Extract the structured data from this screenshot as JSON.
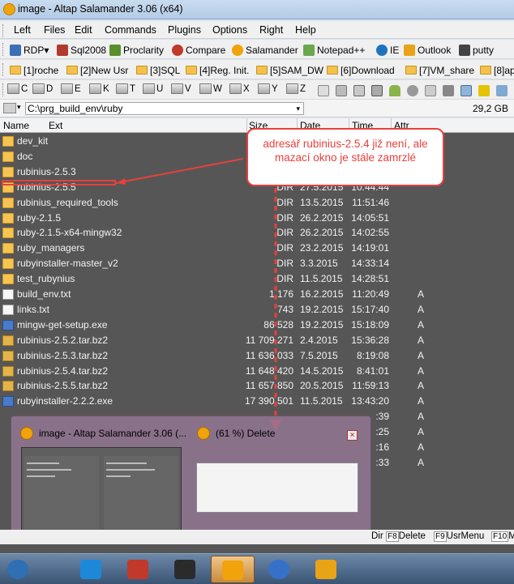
{
  "window": {
    "title": "image - Altap Salamander 3.06 (x64)"
  },
  "menu": [
    "Left",
    "Files",
    "Edit",
    "Commands",
    "Plugins",
    "Options",
    "Right",
    "Help"
  ],
  "toolbar_apps": [
    {
      "label": "RDP",
      "icon": "rdp-icon",
      "color": "#3d6fb6"
    },
    {
      "label": "Sql2008",
      "icon": "sql-icon",
      "color": "#b03a2e"
    },
    {
      "label": "Proclarity",
      "icon": "proclarity-icon",
      "color": "#5a8f2e"
    },
    {
      "label": "Compare",
      "icon": "compare-icon",
      "color": "#c0392b"
    },
    {
      "label": "Salamander",
      "icon": "salamander-icon",
      "color": "#f0a30a"
    },
    {
      "label": "Notepad++",
      "icon": "notepad-icon",
      "color": "#6aa84f"
    },
    {
      "label": "IE",
      "icon": "ie-icon",
      "color": "#1e73be"
    },
    {
      "label": "Outlook",
      "icon": "outlook-icon",
      "color": "#e8a317"
    },
    {
      "label": "putty",
      "icon": "putty-icon",
      "color": "#444444"
    }
  ],
  "toolbar_folders": [
    "[1]roche",
    "[2]New Usr",
    "[3]SQL",
    "[4]Reg. Init.",
    "[5]SAM_DW",
    "[6]Download",
    "[7]VM_share",
    "[8]ap"
  ],
  "drives": [
    "C",
    "D",
    "E",
    "K",
    "T",
    "U",
    "V",
    "W",
    "X",
    "Y",
    "Z"
  ],
  "path": {
    "value": "C:\\prg_build_env\\ruby",
    "free": "29,2 GB"
  },
  "columns": {
    "name": "Name",
    "ext": "Ext",
    "size": "Size",
    "date": "Date",
    "time": "Time",
    "attr": "Attr"
  },
  "files": [
    {
      "name": "dev_kit",
      "size": "",
      "date": "",
      "time": "",
      "attr": "",
      "type": "folder"
    },
    {
      "name": "doc",
      "size": "",
      "date": "",
      "time": "",
      "attr": "",
      "type": "folder"
    },
    {
      "name": "rubinius-2.5.3",
      "size": "",
      "date": "",
      "time": "",
      "attr": "",
      "type": "folder"
    },
    {
      "name": "rubinius-2.5.5",
      "size": "DIR",
      "date": "27.5.2015",
      "time": "10:44:44",
      "attr": "",
      "type": "folder"
    },
    {
      "name": "rubinius_required_tools",
      "size": "DIR",
      "date": "13.5.2015",
      "time": "11:51:46",
      "attr": "",
      "type": "folder"
    },
    {
      "name": "ruby-2.1.5",
      "size": "DIR",
      "date": "26.2.2015",
      "time": "14:05:51",
      "attr": "",
      "type": "folder"
    },
    {
      "name": "ruby-2.1.5-x64-mingw32",
      "size": "DIR",
      "date": "26.2.2015",
      "time": "14:02:55",
      "attr": "",
      "type": "folder"
    },
    {
      "name": "ruby_managers",
      "size": "DIR",
      "date": "23.2.2015",
      "time": "14:19:01",
      "attr": "",
      "type": "folder"
    },
    {
      "name": "rubyinstaller-master_v2",
      "size": "DIR",
      "date": "3.3.2015",
      "time": "14:33:14",
      "attr": "",
      "type": "folder"
    },
    {
      "name": "test_rubynius",
      "size": "DIR",
      "date": "11.5.2015",
      "time": "14:28:51",
      "attr": "",
      "type": "folder"
    },
    {
      "name": "build_env.txt",
      "size": "1 176",
      "date": "16.2.2015",
      "time": "11:20:49",
      "attr": "A",
      "type": "txt"
    },
    {
      "name": "links.txt",
      "size": "743",
      "date": "19.2.2015",
      "time": "15:17:40",
      "attr": "A",
      "type": "txt"
    },
    {
      "name": "mingw-get-setup.exe",
      "size": "86 528",
      "date": "19.2.2015",
      "time": "15:18:09",
      "attr": "A",
      "type": "exe"
    },
    {
      "name": "rubinius-2.5.2.tar.bz2",
      "size": "11 709 271",
      "date": "2.4.2015",
      "time": "15:36:28",
      "attr": "A",
      "type": "bz2"
    },
    {
      "name": "rubinius-2.5.3.tar.bz2",
      "size": "11 636 033",
      "date": "7.5.2015",
      "time": "8:19:08",
      "attr": "A",
      "type": "bz2"
    },
    {
      "name": "rubinius-2.5.4.tar.bz2",
      "size": "11 648 420",
      "date": "14.5.2015",
      "time": "8:41:01",
      "attr": "A",
      "type": "bz2"
    },
    {
      "name": "rubinius-2.5.5.tar.bz2",
      "size": "11 657 850",
      "date": "20.5.2015",
      "time": "11:59:13",
      "attr": "A",
      "type": "bz2"
    },
    {
      "name": "rubyinstaller-2.2.2.exe",
      "size": "17 390 501",
      "date": "11.5.2015",
      "time": "13:43:20",
      "attr": "A",
      "type": "exe"
    },
    {
      "name": "",
      "size": "",
      "date": "",
      "time": ":39",
      "attr": "A",
      "type": "none"
    },
    {
      "name": "",
      "size": "",
      "date": "",
      "time": ":25",
      "attr": "A",
      "type": "none"
    },
    {
      "name": "",
      "size": "",
      "date": "",
      "time": ":16",
      "attr": "A",
      "type": "none"
    },
    {
      "name": "",
      "size": "",
      "date": "",
      "time": ":33",
      "attr": "A",
      "type": "none"
    }
  ],
  "callout": {
    "text": "adresář rubinius-2.5.4 již není, ale mazací okno je stále zamrzlé"
  },
  "thumbnails": {
    "main_title": "image - Altap Salamander 3.06 (...",
    "delete_title": "(61 %) Delete",
    "close_glyph": "×"
  },
  "keybar": [
    {
      "key": "",
      "label": "Dir"
    },
    {
      "key": "F8",
      "label": "Delete"
    },
    {
      "key": "F9",
      "label": "UsrMenu"
    },
    {
      "key": "F10",
      "label": "M"
    }
  ],
  "taskbar": [
    {
      "name": "taskbar-start-orb",
      "color": "#2f6fb3",
      "active": false
    },
    {
      "name": "taskbar-ie",
      "color": "#1e88d8",
      "active": false
    },
    {
      "name": "taskbar-sql-server",
      "color": "#c0392b",
      "active": false
    },
    {
      "name": "taskbar-console",
      "color": "#2b2b2b",
      "active": false
    },
    {
      "name": "taskbar-salamander",
      "color": "#f0a30a",
      "active": true
    },
    {
      "name": "taskbar-globe",
      "color": "#3572c7",
      "active": false
    },
    {
      "name": "taskbar-outlook",
      "color": "#e8a317",
      "active": false
    }
  ]
}
